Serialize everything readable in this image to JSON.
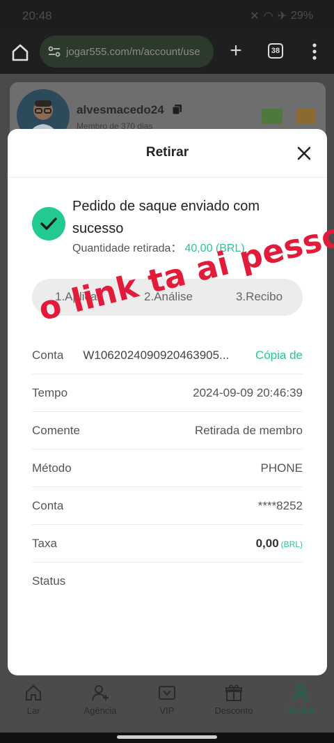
{
  "status_bar": {
    "time": "20:48",
    "battery": "29%"
  },
  "browser": {
    "url": "jogar555.com/m/account/use",
    "tab_count": "38"
  },
  "profile": {
    "username": "alvesmacedo24",
    "member_since": "Membro de 370 dias"
  },
  "modal": {
    "title": "Retirar",
    "success_message": "Pedido de saque enviado com sucesso",
    "amount_label": "Quantidade retirada：",
    "amount_value": "40,00 (BRL)",
    "steps": [
      "1.Aplicar",
      "2.Análise",
      "3.Recibo"
    ],
    "order": {
      "label": "Conta",
      "value": "W1062024090920463905...",
      "copy_label": "Cópia de"
    },
    "rows": [
      {
        "label": "Tempo",
        "value": "2024-09-09 20:46:39"
      },
      {
        "label": "Comente",
        "value": "Retirada de membro"
      },
      {
        "label": "Método",
        "value": "PHONE"
      },
      {
        "label": "Conta",
        "value": "****8252"
      },
      {
        "label": "Taxa",
        "value": "0,00",
        "unit": "(BRL)"
      },
      {
        "label": "Status",
        "value": ""
      }
    ]
  },
  "overlay_text": "o link ta ai pessoal",
  "nav": [
    {
      "label": "Lar",
      "icon": "home-icon"
    },
    {
      "label": "Agência",
      "icon": "add-user-icon"
    },
    {
      "label": "VIP",
      "icon": "vip-icon"
    },
    {
      "label": "Desconto",
      "icon": "gift-icon"
    },
    {
      "label": "Minha",
      "icon": "user-icon",
      "active": true
    }
  ],
  "colors": {
    "accent": "#23c993",
    "overlay_red": "#e31b3a"
  }
}
